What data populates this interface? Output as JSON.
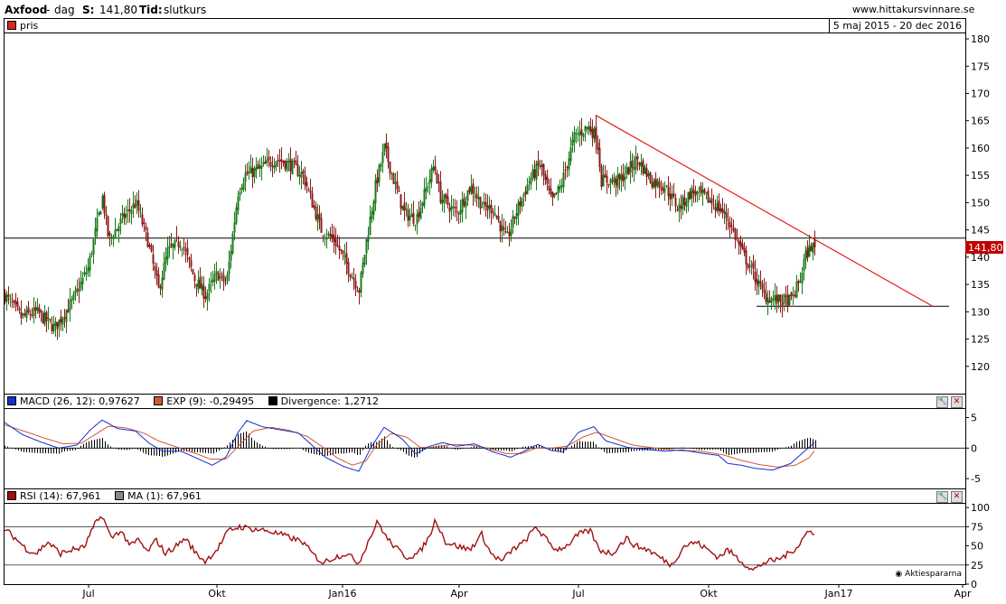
{
  "header": {
    "company": "Axfood",
    "sep": "-",
    "period": "dag",
    "s_label": "S:",
    "s_value": "141,80",
    "tid_label": "Tid:",
    "tid_value": "slutkurs",
    "site": "www.hittakursvinnare.se"
  },
  "colors": {
    "up": "#1b7a1b",
    "down": "#8b1a1a",
    "trend": "#e02020",
    "macd": "#1530d0",
    "exp": "#d05a30",
    "rsi": "#a01010",
    "price_tag": "#c00000"
  },
  "price_panel": {
    "legend": "pris",
    "date_range": "5 maj 2015 - 20 dec 2016",
    "current_tag": "141,80"
  },
  "macd_panel": {
    "macd_label": "MACD (26, 12): 0,97627",
    "exp_label": "EXP (9): -0,29495",
    "div_label": "Divergence: 1,2712",
    "tool_icon": "wrench-icon",
    "close_icon": "close-icon"
  },
  "rsi_panel": {
    "rsi_label": "RSI (14): 67,961",
    "ma_label": "MA (1): 67,961",
    "brand": "Aktiespararna",
    "tool_icon": "wrench-icon",
    "close_icon": "close-icon"
  },
  "chart_data": [
    {
      "type": "candlestick",
      "title": "Axfood - dag",
      "x_labels": [
        "Jul",
        "Okt",
        "Jan16",
        "Apr",
        "Jul",
        "Okt",
        "Jan17",
        "Apr"
      ],
      "y_ticks": [
        120,
        125,
        130,
        135,
        140,
        145,
        150,
        155,
        160,
        165,
        170,
        175,
        180
      ],
      "ylim": [
        115,
        181
      ],
      "last_close": 141.8,
      "price_waypoints": [
        [
          0,
          133
        ],
        [
          18,
          129
        ],
        [
          35,
          130
        ],
        [
          55,
          127
        ],
        [
          75,
          132
        ],
        [
          92,
          138
        ],
        [
          108,
          151
        ],
        [
          115,
          143
        ],
        [
          130,
          147
        ],
        [
          145,
          150
        ],
        [
          158,
          143
        ],
        [
          170,
          134
        ],
        [
          180,
          141
        ],
        [
          195,
          143
        ],
        [
          210,
          136
        ],
        [
          222,
          133
        ],
        [
          235,
          137
        ],
        [
          245,
          135
        ],
        [
          258,
          152
        ],
        [
          265,
          155
        ],
        [
          280,
          156
        ],
        [
          300,
          158
        ],
        [
          315,
          157
        ],
        [
          330,
          155
        ],
        [
          340,
          150
        ],
        [
          350,
          145
        ],
        [
          365,
          143
        ],
        [
          380,
          138
        ],
        [
          392,
          134
        ],
        [
          400,
          143
        ],
        [
          410,
          153
        ],
        [
          420,
          160
        ],
        [
          432,
          153
        ],
        [
          442,
          148
        ],
        [
          455,
          147
        ],
        [
          465,
          152
        ],
        [
          475,
          157
        ],
        [
          482,
          151
        ],
        [
          500,
          148
        ],
        [
          515,
          153
        ],
        [
          530,
          149
        ],
        [
          540,
          149
        ],
        [
          555,
          143
        ],
        [
          565,
          148
        ],
        [
          580,
          154
        ],
        [
          592,
          157
        ],
        [
          605,
          150
        ],
        [
          615,
          153
        ],
        [
          630,
          162
        ],
        [
          645,
          164
        ],
        [
          655,
          162
        ],
        [
          660,
          154
        ],
        [
          680,
          154
        ],
        [
          700,
          158
        ],
        [
          715,
          154
        ],
        [
          730,
          153
        ],
        [
          745,
          149
        ],
        [
          760,
          152
        ],
        [
          775,
          151
        ],
        [
          790,
          149
        ],
        [
          800,
          147
        ],
        [
          815,
          141
        ],
        [
          825,
          138
        ],
        [
          840,
          133
        ],
        [
          855,
          132
        ],
        [
          870,
          132
        ],
        [
          880,
          136
        ],
        [
          885,
          140
        ],
        [
          892,
          142
        ],
        [
          897,
          141.8
        ]
      ],
      "trendline": [
        [
          654,
          166
        ],
        [
          1027,
          131
        ]
      ],
      "support_line": {
        "y": 131,
        "x_from": 832,
        "x_to": 1045
      },
      "horizontal_level": 143.5
    },
    {
      "type": "line",
      "title": "MACD (26, 12)",
      "y_ticks": [
        -5,
        0,
        5
      ],
      "ylim": [
        -6.6,
        6.4
      ],
      "series": [
        {
          "name": "MACD (26, 12)",
          "values": [
            [
              0,
              4.2
            ],
            [
              20,
              2.2
            ],
            [
              40,
              1
            ],
            [
              60,
              0
            ],
            [
              80,
              0.5
            ],
            [
              95,
              3
            ],
            [
              108,
              4.6
            ],
            [
              125,
              3.2
            ],
            [
              145,
              2.8
            ],
            [
              160,
              0.8
            ],
            [
              175,
              -0.5
            ],
            [
              195,
              -0.5
            ],
            [
              215,
              -1.8
            ],
            [
              230,
              -2.8
            ],
            [
              245,
              -1.5
            ],
            [
              258,
              2.5
            ],
            [
              268,
              4.5
            ],
            [
              285,
              3.5
            ],
            [
              305,
              3
            ],
            [
              325,
              2.5
            ],
            [
              340,
              0.5
            ],
            [
              355,
              -1.5
            ],
            [
              375,
              -3
            ],
            [
              392,
              -3.8
            ],
            [
              405,
              0
            ],
            [
              420,
              3.4
            ],
            [
              440,
              1.5
            ],
            [
              455,
              -1
            ],
            [
              470,
              0.3
            ],
            [
              485,
              0.9
            ],
            [
              500,
              0.3
            ],
            [
              520,
              0.7
            ],
            [
              540,
              -0.6
            ],
            [
              560,
              -1.5
            ],
            [
              575,
              -0.5
            ],
            [
              590,
              0.6
            ],
            [
              605,
              -0.4
            ],
            [
              618,
              -0.6
            ],
            [
              635,
              2.6
            ],
            [
              652,
              3.5
            ],
            [
              665,
              1.2
            ],
            [
              690,
              0.1
            ],
            [
              710,
              -0.2
            ],
            [
              730,
              -0.5
            ],
            [
              750,
              -0.3
            ],
            [
              770,
              -0.8
            ],
            [
              790,
              -1.2
            ],
            [
              800,
              -2.5
            ],
            [
              815,
              -2.8
            ],
            [
              830,
              -3.3
            ],
            [
              850,
              -3.6
            ],
            [
              870,
              -2.5
            ],
            [
              885,
              -0.5
            ],
            [
              897,
              1.0
            ]
          ]
        },
        {
          "name": "EXP (9)",
          "values": [
            [
              0,
              3.8
            ],
            [
              25,
              2.6
            ],
            [
              45,
              1.6
            ],
            [
              65,
              0.7
            ],
            [
              85,
              0.8
            ],
            [
              100,
              2.2
            ],
            [
              115,
              3.6
            ],
            [
              135,
              3.3
            ],
            [
              155,
              2.4
            ],
            [
              170,
              1.2
            ],
            [
              190,
              0.2
            ],
            [
              210,
              -0.8
            ],
            [
              228,
              -1.8
            ],
            [
              245,
              -1.8
            ],
            [
              260,
              0.5
            ],
            [
              275,
              2.8
            ],
            [
              295,
              3.4
            ],
            [
              315,
              2.9
            ],
            [
              335,
              1.9
            ],
            [
              350,
              0.4
            ],
            [
              368,
              -1.6
            ],
            [
              385,
              -2.8
            ],
            [
              400,
              -2.1
            ],
            [
              412,
              0.6
            ],
            [
              428,
              2.4
            ],
            [
              445,
              1.8
            ],
            [
              460,
              0.1
            ],
            [
              478,
              0.2
            ],
            [
              495,
              0.6
            ],
            [
              515,
              0.5
            ],
            [
              535,
              0
            ],
            [
              555,
              -0.9
            ],
            [
              572,
              -0.9
            ],
            [
              588,
              0
            ],
            [
              605,
              0
            ],
            [
              622,
              0.3
            ],
            [
              640,
              1.8
            ],
            [
              655,
              2.6
            ],
            [
              672,
              1.7
            ],
            [
              695,
              0.5
            ],
            [
              720,
              0
            ],
            [
              745,
              -0.4
            ],
            [
              770,
              -0.5
            ],
            [
              795,
              -1.1
            ],
            [
              815,
              -2.0
            ],
            [
              835,
              -2.7
            ],
            [
              855,
              -3.1
            ],
            [
              875,
              -2.8
            ],
            [
              890,
              -1.6
            ],
            [
              897,
              -0.3
            ]
          ]
        }
      ]
    },
    {
      "type": "line",
      "title": "RSI (14)",
      "y_ticks": [
        0,
        25,
        50,
        75,
        100
      ],
      "ylim": [
        0,
        105
      ],
      "reference_lines": [
        25,
        75
      ],
      "series": [
        {
          "name": "RSI (14)",
          "values": [
            [
              0,
              72
            ],
            [
              12,
              60
            ],
            [
              25,
              45
            ],
            [
              35,
              40
            ],
            [
              48,
              55
            ],
            [
              62,
              40
            ],
            [
              75,
              45
            ],
            [
              88,
              48
            ],
            [
              100,
              78
            ],
            [
              108,
              90
            ],
            [
              118,
              60
            ],
            [
              128,
              70
            ],
            [
              140,
              50
            ],
            [
              148,
              58
            ],
            [
              158,
              42
            ],
            [
              168,
              58
            ],
            [
              178,
              40
            ],
            [
              190,
              50
            ],
            [
              200,
              60
            ],
            [
              212,
              40
            ],
            [
              222,
              30
            ],
            [
              235,
              45
            ],
            [
              248,
              70
            ],
            [
              260,
              75
            ],
            [
              275,
              72
            ],
            [
              290,
              70
            ],
            [
              305,
              65
            ],
            [
              318,
              60
            ],
            [
              330,
              55
            ],
            [
              342,
              38
            ],
            [
              352,
              28
            ],
            [
              365,
              35
            ],
            [
              378,
              40
            ],
            [
              392,
              28
            ],
            [
              402,
              55
            ],
            [
              413,
              82
            ],
            [
              423,
              60
            ],
            [
              435,
              45
            ],
            [
              445,
              35
            ],
            [
              458,
              40
            ],
            [
              470,
              62
            ],
            [
              477,
              85
            ],
            [
              488,
              55
            ],
            [
              500,
              50
            ],
            [
              515,
              45
            ],
            [
              528,
              65
            ],
            [
              538,
              40
            ],
            [
              550,
              30
            ],
            [
              562,
              45
            ],
            [
              575,
              55
            ],
            [
              588,
              75
            ],
            [
              598,
              60
            ],
            [
              610,
              45
            ],
            [
              622,
              50
            ],
            [
              635,
              65
            ],
            [
              648,
              70
            ],
            [
              658,
              45
            ],
            [
              672,
              40
            ],
            [
              688,
              60
            ],
            [
              698,
              50
            ],
            [
              712,
              45
            ],
            [
              725,
              35
            ],
            [
              738,
              25
            ],
            [
              752,
              50
            ],
            [
              765,
              55
            ],
            [
              778,
              45
            ],
            [
              790,
              35
            ],
            [
              800,
              45
            ],
            [
              815,
              30
            ],
            [
              828,
              18
            ],
            [
              840,
              28
            ],
            [
              855,
              32
            ],
            [
              868,
              40
            ],
            [
              878,
              50
            ],
            [
              888,
              68
            ],
            [
              897,
              68
            ]
          ]
        }
      ]
    }
  ]
}
